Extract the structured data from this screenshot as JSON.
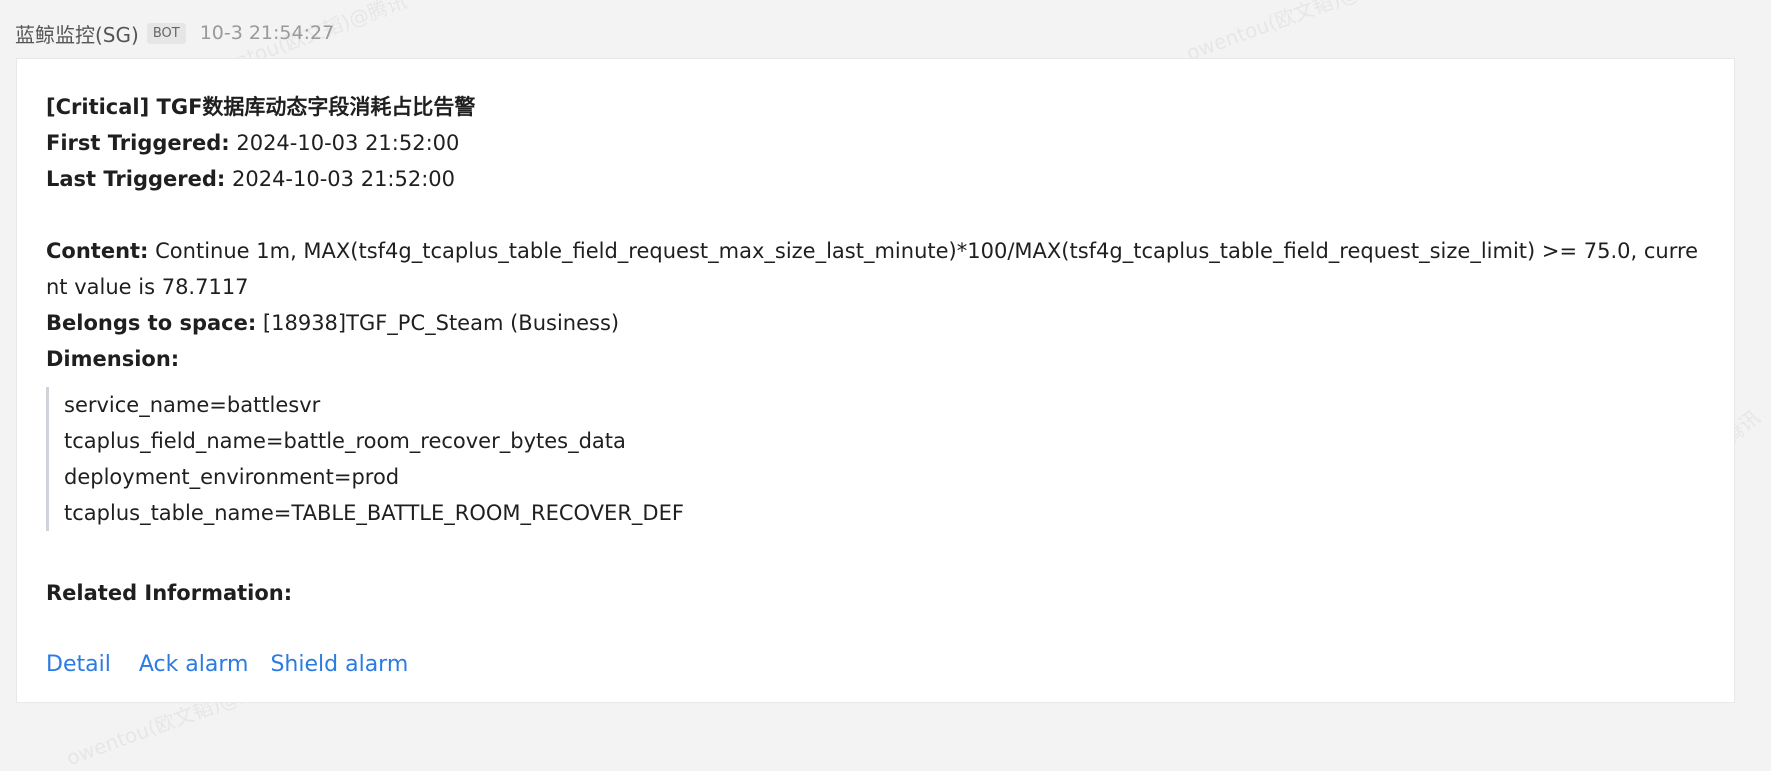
{
  "header": {
    "sender": "蓝鲸监控(SG)",
    "badge": "BOT",
    "timestamp": "10-3 21:54:27"
  },
  "card": {
    "title": "[Critical] TGF数据库动态字段消耗占比告警",
    "first_triggered_label": "First Triggered:",
    "first_triggered_value": " 2024-10-03 21:52:00",
    "last_triggered_label": "Last Triggered:",
    "last_triggered_value": " 2024-10-03 21:52:00",
    "content_label": "Content:",
    "content_value": " Continue 1m, MAX(tsf4g_tcaplus_table_field_request_max_size_last_minute)*100/MAX(tsf4g_tcaplus_table_field_request_size_limit) >= 75.0, current value is 78.7117",
    "space_label": "Belongs to space:",
    "space_value": " [18938]TGF_PC_Steam (Business)",
    "dimension_label": "Dimension:",
    "dimensions": [
      "service_name=battlesvr",
      "tcaplus_field_name=battle_room_recover_bytes_data",
      "deployment_environment=prod",
      "tcaplus_table_name=TABLE_BATTLE_ROOM_RECOVER_DEF"
    ],
    "related_label": "Related Information:",
    "actions": {
      "detail": "Detail",
      "ack": "Ack alarm",
      "shield": "Shield alarm"
    }
  },
  "colors": {
    "link": "#2a7be4",
    "background": "#f3f3f3",
    "card": "#ffffff",
    "quote_bar": "#cfd3da"
  },
  "watermarks": [
    "owentou(欧文韬)@腾讯",
    "owentou(欧文韬)@腾讯",
    "owentou(欧文韬)@腾讯",
    "owentou(欧文韬)@腾讯"
  ]
}
